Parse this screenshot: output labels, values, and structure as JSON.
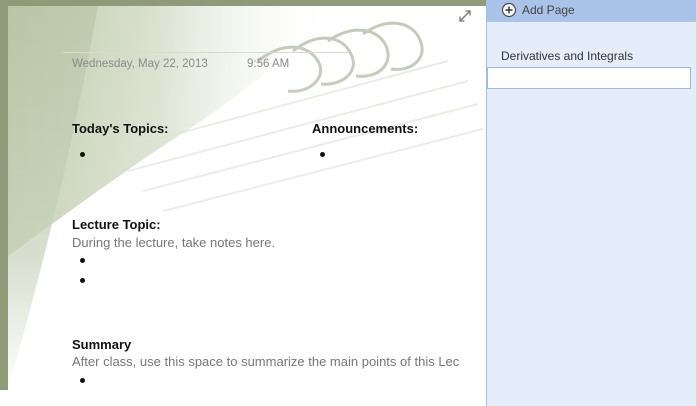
{
  "page": {
    "date": "Wednesday, May 22, 2013",
    "time": "9:56 AM",
    "sections": {
      "todays_topics": {
        "heading": "Today's Topics:",
        "bullets": [
          ""
        ]
      },
      "announcements": {
        "heading": "Announcements:",
        "bullets": [
          ""
        ]
      },
      "lecture": {
        "heading": "Lecture Topic:",
        "body": "During the lecture, take notes here.",
        "bullets": [
          "",
          ""
        ]
      },
      "summary": {
        "heading": "Summary",
        "body": "After class, use this space to summarize the main points of this Lec",
        "bullets": [
          ""
        ]
      }
    },
    "icons": {
      "expand": "expand-arrows-icon"
    },
    "colors": {
      "page_border": "#8f9a78",
      "background_art": "#c5d0b5",
      "muted_text": "#8a8a8a",
      "body_text": "#111111"
    }
  },
  "sidebar": {
    "add_page_label": "Add Page",
    "add_page_icon": "plus-circle-icon",
    "pages": [
      {
        "label": "Derivatives and Integrals"
      }
    ],
    "new_page_input_value": "",
    "colors": {
      "pane_bg": "#e4edf9",
      "add_bar_bg": "#a9c4e8",
      "input_border": "#9bbbe3"
    }
  }
}
